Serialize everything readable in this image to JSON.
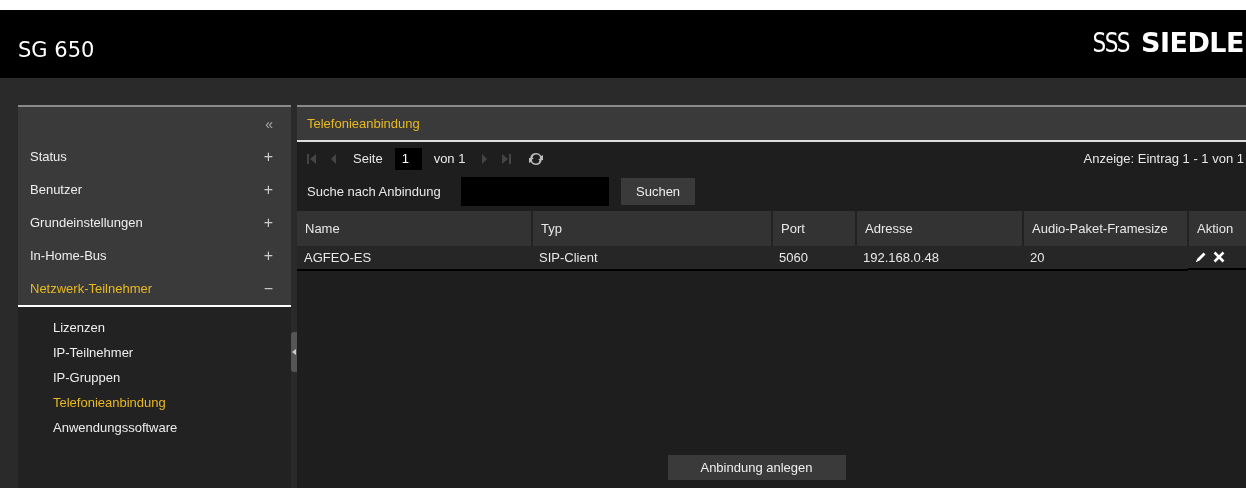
{
  "header": {
    "title": "SG 650",
    "logo_light": "SSS",
    "logo_bold": "SIEDLE"
  },
  "sidebar": {
    "collapse": "«",
    "items": [
      {
        "label": "Status",
        "expanded": false,
        "toggle": "+"
      },
      {
        "label": "Benutzer",
        "expanded": false,
        "toggle": "+"
      },
      {
        "label": "Grundeinstellungen",
        "expanded": false,
        "toggle": "+"
      },
      {
        "label": "In-Home-Bus",
        "expanded": false,
        "toggle": "+"
      },
      {
        "label": "Netzwerk-Teilnehmer",
        "expanded": true,
        "toggle": "−",
        "children": [
          {
            "label": "Lizenzen",
            "selected": false
          },
          {
            "label": "IP-Teilnehmer",
            "selected": false
          },
          {
            "label": "IP-Gruppen",
            "selected": false
          },
          {
            "label": "Telefonieanbindung",
            "selected": true
          },
          {
            "label": "Anwendungssoftware",
            "selected": false
          }
        ]
      }
    ]
  },
  "panel": {
    "title": "Telefonieanbindung",
    "pager": {
      "nav": [
        {
          "kind": "first",
          "disabled": true
        },
        {
          "kind": "prev",
          "disabled": true
        },
        {
          "kind": "next",
          "disabled": true
        },
        {
          "kind": "last",
          "disabled": true
        }
      ],
      "page_label": "Seite",
      "page_value": "1",
      "of_label": "von 1",
      "summary": "Anzeige: Eintrag 1 - 1 von 1"
    },
    "search": {
      "label": "Suche nach Anbindung",
      "button": "Suchen"
    },
    "table": {
      "columns": [
        "Name",
        "Typ",
        "Port",
        "Adresse",
        "Audio-Paket-Framesize",
        "Aktion"
      ],
      "rows": [
        {
          "cells": [
            "AGFEO-ES",
            "SIP-Client",
            "5060",
            "192.168.0.48",
            "20"
          ]
        }
      ]
    },
    "add_button": "Anbindung anlegen"
  }
}
